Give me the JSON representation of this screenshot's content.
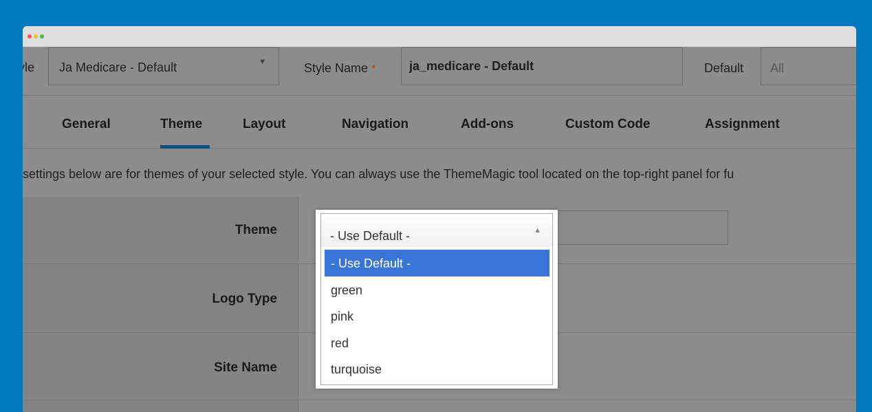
{
  "style_bar": {
    "style_label_partial": "yle",
    "style_select_value": "Ja Medicare - Default",
    "style_name_label": "Style Name",
    "required_mark": "*",
    "style_name_value": "ja_medicare - Default",
    "default_label": "Default",
    "default_value": "All"
  },
  "tabs": [
    {
      "label": "General"
    },
    {
      "label": "Theme",
      "active": true
    },
    {
      "label": "Layout"
    },
    {
      "label": "Navigation"
    },
    {
      "label": "Add-ons"
    },
    {
      "label": "Custom Code"
    },
    {
      "label": "Assignment"
    }
  ],
  "description": "settings below are for themes of your selected style. You can always use the ThemeMagic tool located on the top-right panel for fu",
  "form": {
    "rows": [
      {
        "label": "Theme"
      },
      {
        "label": "Logo Type"
      },
      {
        "label": "Site Name"
      }
    ]
  },
  "theme_dropdown": {
    "selected": "- Use Default -",
    "options": [
      "- Use Default -",
      "green",
      "pink",
      "red",
      "turquoise"
    ]
  },
  "colors": {
    "page_bg": "#0077be",
    "overlay": "#8c8c8c",
    "active_tab_underline": "#0a4f84",
    "dropdown_highlight": "#3875d7"
  }
}
